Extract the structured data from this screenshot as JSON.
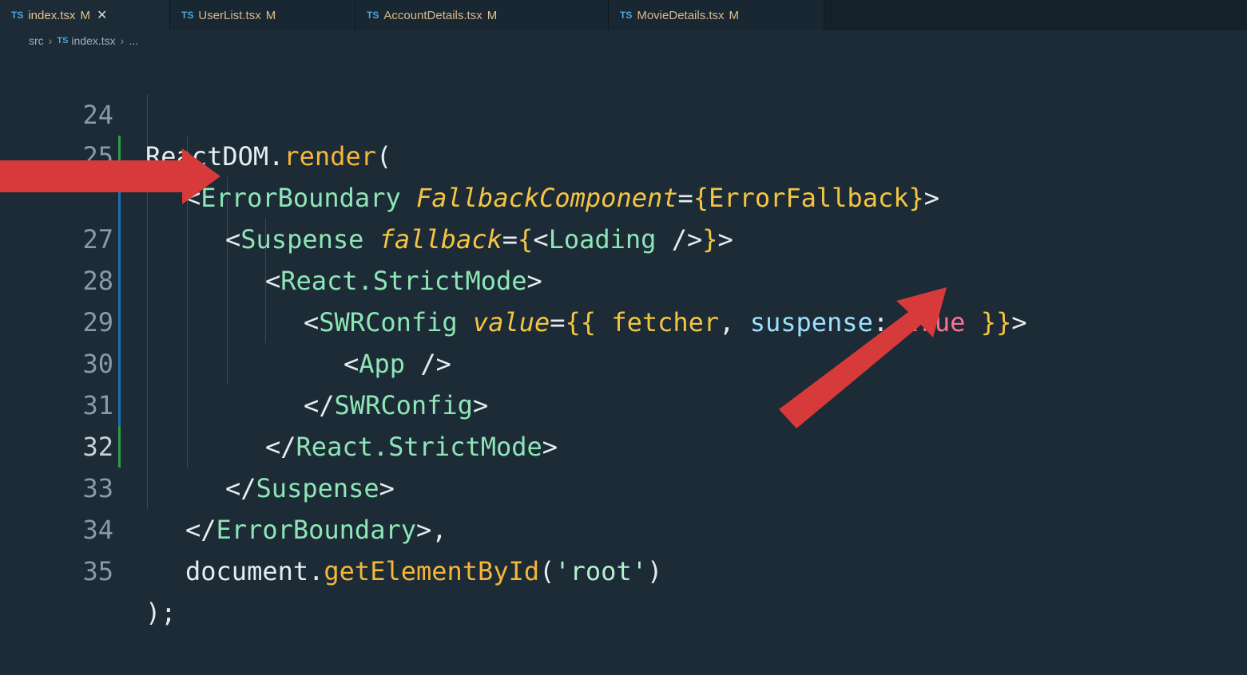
{
  "tabs": [
    {
      "lang": "TS",
      "name": "index.tsx",
      "status": "M",
      "close": "✕",
      "active": true
    },
    {
      "lang": "TS",
      "name": "UserList.tsx",
      "status": "M",
      "active": false
    },
    {
      "lang": "TS",
      "name": "AccountDetails.tsx",
      "status": "M",
      "active": false
    },
    {
      "lang": "TS",
      "name": "MovieDetails.tsx",
      "status": "M",
      "active": false
    }
  ],
  "breadcrumb": {
    "folder": "src",
    "lang": "TS",
    "file": "index.tsx",
    "symbol": "..."
  },
  "lines": [
    {
      "num": "24"
    },
    {
      "num": "25"
    },
    {
      "num": ""
    },
    {
      "num": "27"
    },
    {
      "num": "28"
    },
    {
      "num": "29"
    },
    {
      "num": "30"
    },
    {
      "num": "31"
    },
    {
      "num": "32"
    },
    {
      "num": "33"
    },
    {
      "num": "34"
    },
    {
      "num": "35"
    }
  ],
  "code": {
    "l24": {
      "obj": "ReactDOM.",
      "fn": "render",
      "paren": "("
    },
    "l25": {
      "open": "<",
      "tag": "ErrorBoundary",
      "attr": "FallbackComponent",
      "eq": "=",
      "lb": "{",
      "val": "ErrorFallback",
      "rb": "}",
      "close": ">"
    },
    "l26": {
      "open": "<",
      "tag": "Suspense",
      "attr": "fallback",
      "eq": "=",
      "lb": "{",
      "inner_open": "<",
      "inner_tag": "Loading",
      "inner_close": " />",
      "rb": "}",
      "close": ">"
    },
    "l27": {
      "open": "<",
      "tag": "React.StrictMode",
      "close": ">"
    },
    "l28": {
      "open": "<",
      "tag": "SWRConfig",
      "attr": "value",
      "eq": "=",
      "lb": "{{ ",
      "var": "fetcher",
      "comma": ", ",
      "key": "suspense",
      "colon": ": ",
      "bool": "true",
      "rb": " }}",
      "close": ">"
    },
    "l29": {
      "open": "<",
      "tag": "App",
      "close": " />"
    },
    "l30": {
      "open": "</",
      "tag": "SWRConfig",
      "close": ">"
    },
    "l31": {
      "open": "</",
      "tag": "React.StrictMode",
      "close": ">"
    },
    "l32": {
      "open": "</",
      "tag": "Suspense",
      "close": ">"
    },
    "l33": {
      "open": "</",
      "tag": "ErrorBoundary",
      "close": ">,"
    },
    "l34": {
      "obj": "document.",
      "fn": "getElementById",
      "lp": "(",
      "str": "'root'",
      "rp": ")"
    },
    "l35": {
      "text": ");"
    }
  },
  "colors": {
    "background": "#1c2b35",
    "arrow": "#d63a3a",
    "modified_gutter": "#2ea043"
  },
  "icons": [
    "ts-file-icon",
    "close-icon",
    "breadcrumb-chevron-icon",
    "red-arrow-right",
    "red-arrow-diagonal"
  ]
}
